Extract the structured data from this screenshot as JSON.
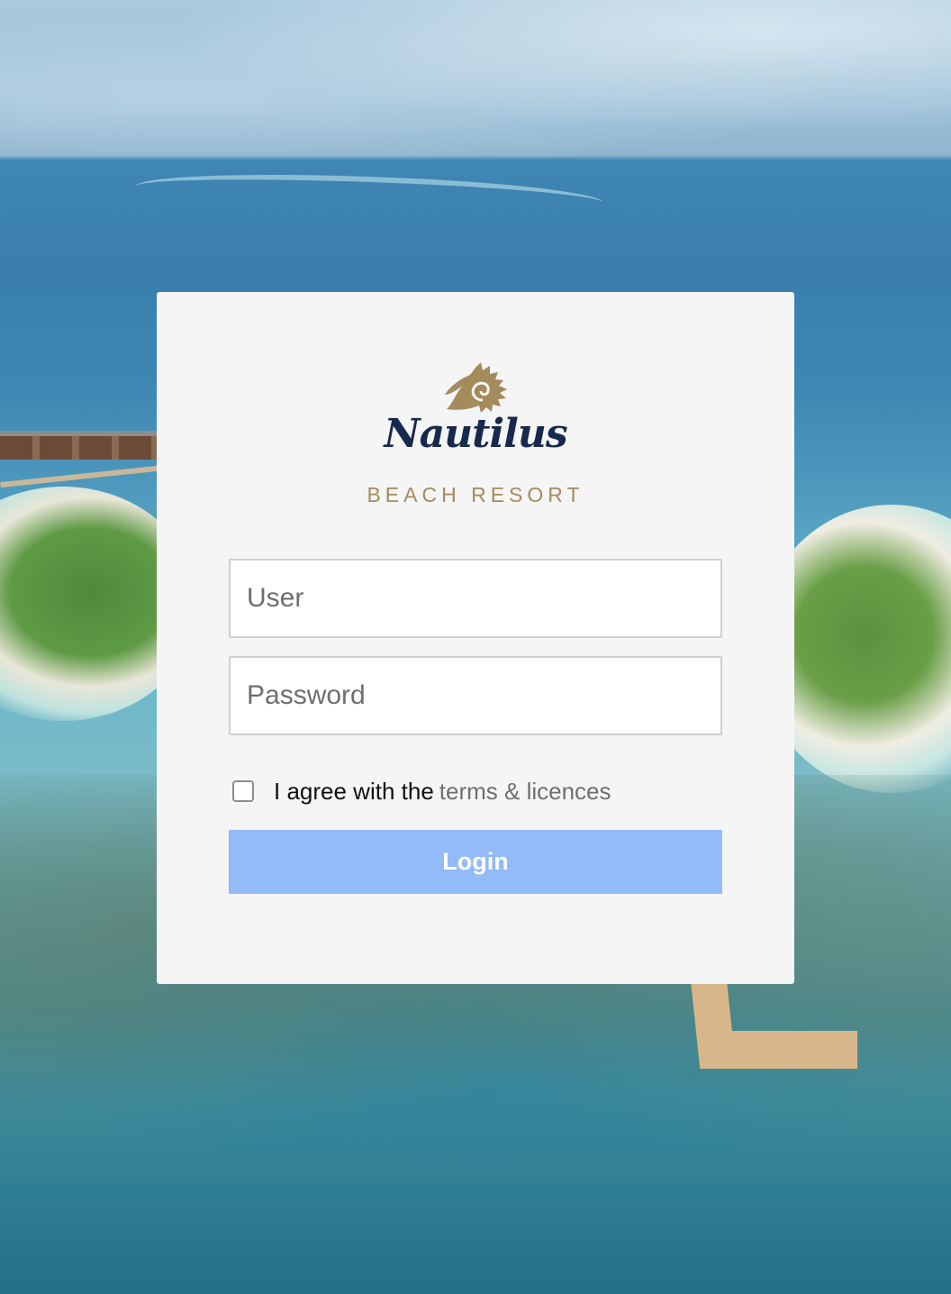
{
  "brand": {
    "name": "Nautilus",
    "tagline": "BEACH RESORT",
    "mark_icon": "nautilus-shell-icon",
    "colors": {
      "navy": "#17294c",
      "gold": "#a48b5c"
    }
  },
  "form": {
    "user_placeholder": "User",
    "password_placeholder": "Password",
    "agree_text": "I agree with the",
    "agree_link": "terms & licences",
    "agree_checked": false,
    "login_label": "Login",
    "login_color": "#92bbf7"
  }
}
